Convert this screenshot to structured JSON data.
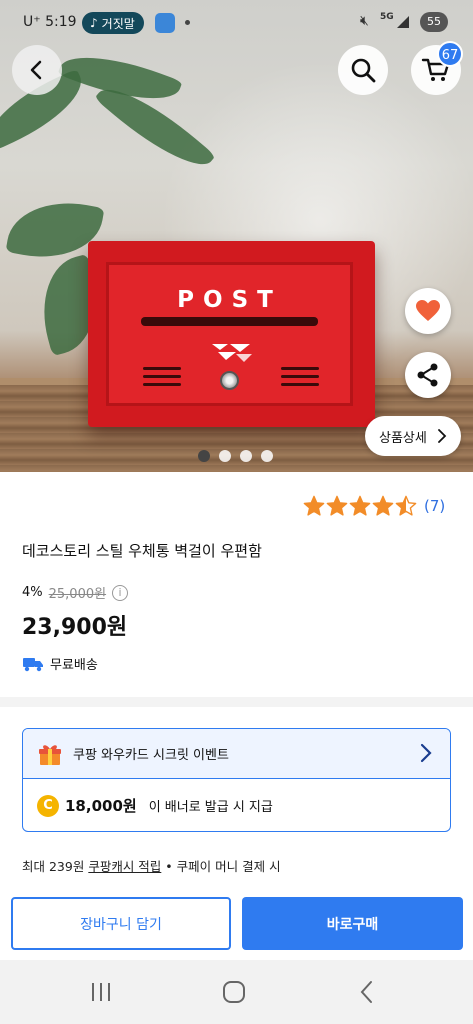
{
  "status_bar": {
    "carrier_time": "U⁺ 5:19",
    "now_playing": "거짓말",
    "network": "5G",
    "battery": "55"
  },
  "header": {
    "cart_count": "67"
  },
  "product_image": {
    "post_text": "POST",
    "detail_button": "상품상세",
    "pager": {
      "count": 4,
      "active_index": 0
    }
  },
  "product": {
    "rating": {
      "value": 4.5,
      "max": 5,
      "review_count": "(7)",
      "star_color": "#f28c28"
    },
    "title": "데코스토리 스틸 우체통 벽걸이 우편함",
    "discount": "4%",
    "original_price": "25,000원",
    "price": "23,900원",
    "shipping": "무료배송"
  },
  "promo": {
    "title": "쿠팡 와우카드 시크릿 이벤트",
    "coin_symbol": "C",
    "amount": "18,000원",
    "note": "이 배너로 발급 시 지급"
  },
  "cash_line": {
    "prefix": "최대 239원",
    "link": "쿠팡캐시 적립",
    "suffix": "• 쿠페이 머니 결제 시"
  },
  "actions": {
    "add_to_cart": "장바구니 담기",
    "buy_now": "바로구매"
  },
  "colors": {
    "accent": "#2f7bf0",
    "mailbox_red": "#d11a1f",
    "heart": "#f0613a"
  }
}
